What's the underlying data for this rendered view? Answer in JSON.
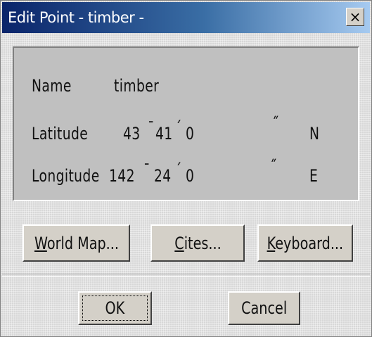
{
  "window": {
    "title": "Edit Point - timber -",
    "close_symbol": "×"
  },
  "fields": {
    "name_label": "Name",
    "name_value": "timber",
    "latitude_label": "Latitude",
    "latitude_deg": "43",
    "latitude_min": "41",
    "latitude_sec": "0",
    "latitude_hemisphere": "N",
    "longitude_label": "Longitude",
    "longitude_deg": "142",
    "longitude_min": "24",
    "longitude_sec": "0",
    "longitude_hemisphere": "E",
    "degree_mark": "¯",
    "minute_mark": "´",
    "second_mark": "˝"
  },
  "buttons": {
    "world_map": {
      "accel": "W",
      "rest": "orld Map..."
    },
    "cities": {
      "accel": "C",
      "rest": "ites..."
    },
    "keyboard": {
      "accel": "K",
      "rest": "eyboard..."
    },
    "ok": "OK",
    "cancel": "Cancel"
  }
}
